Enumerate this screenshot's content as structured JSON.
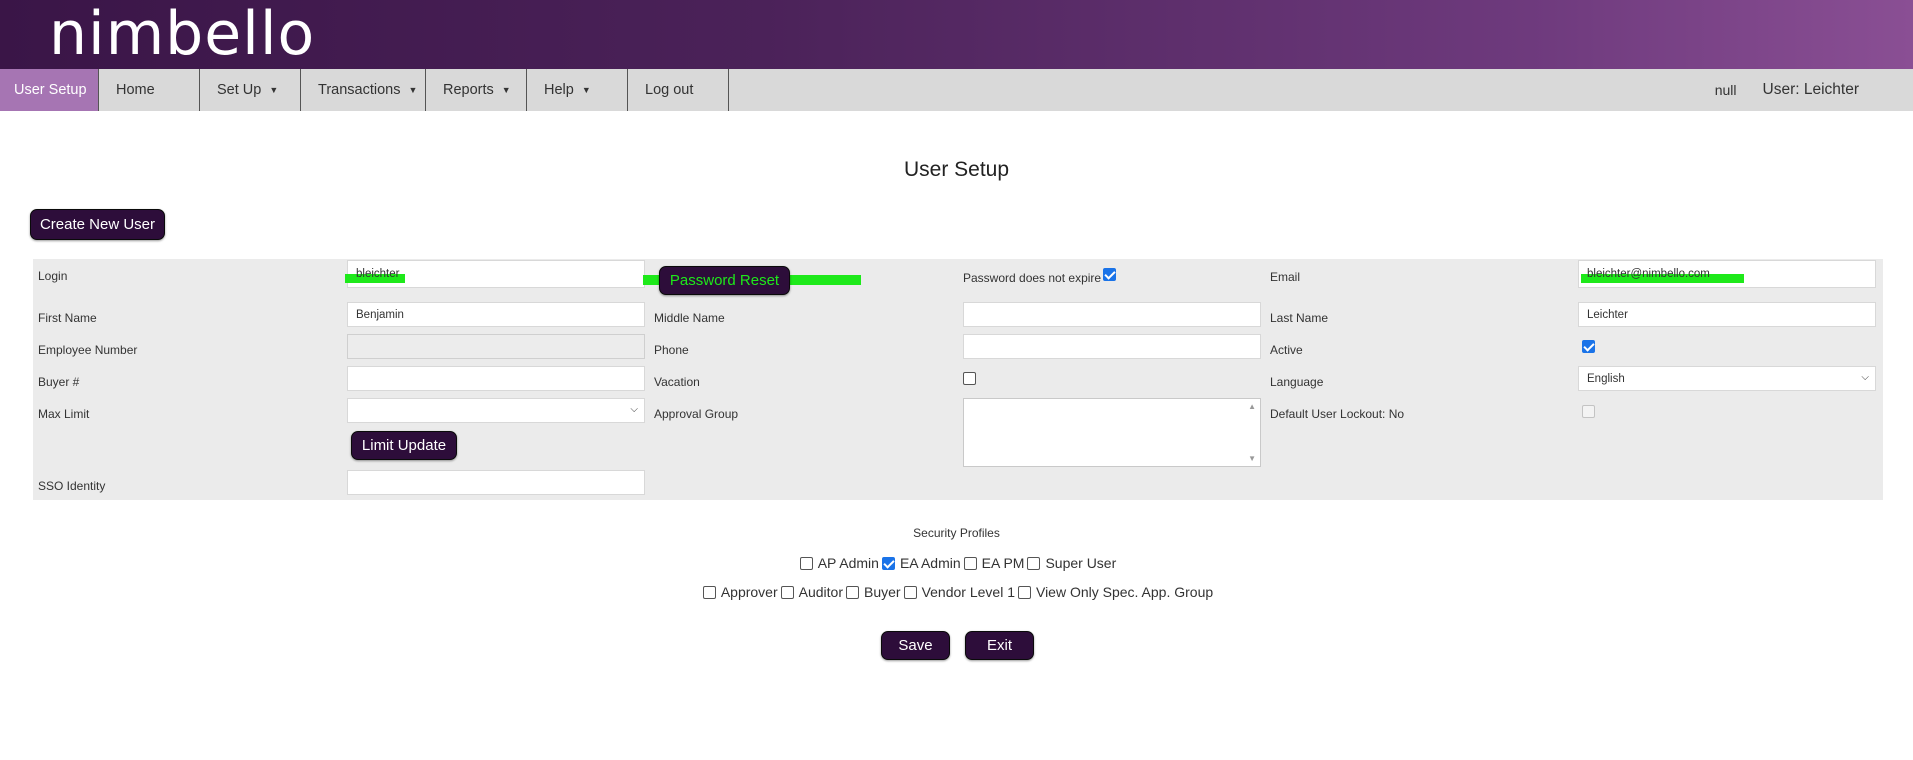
{
  "brand": {
    "logo_text": "nimbello"
  },
  "nav": {
    "items": [
      {
        "label": "User Setup",
        "caret": false
      },
      {
        "label": "Home",
        "caret": false
      },
      {
        "label": "Set Up",
        "caret": true
      },
      {
        "label": "Transactions",
        "caret": true
      },
      {
        "label": "Reports",
        "caret": true
      },
      {
        "label": "Help",
        "caret": true
      },
      {
        "label": "Log out",
        "caret": false
      }
    ],
    "null_text": "null",
    "user_text": "User: Leichter"
  },
  "page": {
    "title": "User Setup",
    "create_button": "Create New User"
  },
  "form": {
    "login": {
      "label": "Login",
      "value": "bleichter"
    },
    "password_reset_button": "Password Reset",
    "password_no_expire": {
      "label": "Password does not expire",
      "checked": true
    },
    "email": {
      "label": "Email",
      "value": "bleichter@nimbello.com"
    },
    "first_name": {
      "label": "First Name",
      "value": "Benjamin"
    },
    "middle_name": {
      "label": "Middle Name",
      "value": ""
    },
    "last_name": {
      "label": "Last Name",
      "value": "Leichter"
    },
    "employee_number": {
      "label": "Employee Number",
      "value": ""
    },
    "phone": {
      "label": "Phone",
      "value": ""
    },
    "active": {
      "label": "Active",
      "checked": true
    },
    "buyer_number": {
      "label": "Buyer #",
      "value": ""
    },
    "vacation": {
      "label": "Vacation",
      "checked": false
    },
    "language": {
      "label": "Language",
      "value": "English"
    },
    "max_limit": {
      "label": "Max Limit",
      "value": ""
    },
    "approval_group": {
      "label": "Approval Group"
    },
    "default_lockout": {
      "label": "Default User Lockout: No",
      "checked": false
    },
    "limit_update_button": "Limit Update",
    "sso_identity": {
      "label": "SSO Identity",
      "value": ""
    }
  },
  "security": {
    "title": "Security Profiles",
    "row1": [
      {
        "label": "AP Admin",
        "checked": false
      },
      {
        "label": "EA Admin",
        "checked": true
      },
      {
        "label": "EA PM",
        "checked": false
      },
      {
        "label": "Super User",
        "checked": false
      }
    ],
    "row2": [
      {
        "label": "Approver",
        "checked": false
      },
      {
        "label": "Auditor",
        "checked": false
      },
      {
        "label": "Buyer",
        "checked": false
      },
      {
        "label": "Vendor Level 1",
        "checked": false
      },
      {
        "label": "View Only Spec. App. Group",
        "checked": false
      }
    ]
  },
  "actions": {
    "save": "Save",
    "exit": "Exit"
  },
  "colors": {
    "brand_dark": "#3a1547",
    "button": "#2d0d3a",
    "active_tab": "#a675b3",
    "highlight": "#1ee91a",
    "checkbox": "#1a73e8"
  }
}
